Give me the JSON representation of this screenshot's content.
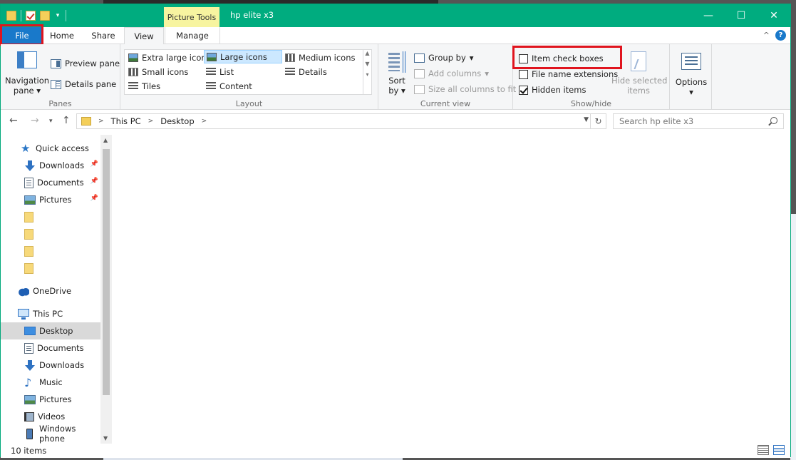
{
  "window": {
    "title": "hp elite x3",
    "context_tab": "Picture Tools",
    "controls": {
      "minimize": "—",
      "maximize": "☐",
      "close": "✕"
    }
  },
  "tabs": {
    "file": "File",
    "home": "Home",
    "share": "Share",
    "view": "View",
    "manage": "Manage"
  },
  "ribbon": {
    "panes": {
      "label": "Panes",
      "navigation_pane": "Navigation",
      "navigation_pane_2": "pane",
      "preview_pane": "Preview pane",
      "details_pane": "Details pane"
    },
    "layout": {
      "label": "Layout",
      "items": [
        "Extra large icons",
        "Large icons",
        "Medium icons",
        "Small icons",
        "List",
        "Details",
        "Tiles",
        "Content"
      ],
      "selected": "Large icons"
    },
    "current_view": {
      "label": "Current view",
      "sort_by": "Sort",
      "sort_by_2": "by",
      "group_by": "Group by",
      "add_columns": "Add columns",
      "size_all_columns": "Size all columns to fit"
    },
    "show_hide": {
      "label": "Show/hide",
      "item_check_boxes": "Item check boxes",
      "file_name_extensions": "File name extensions",
      "hidden_items": "Hidden items",
      "hide_selected": "Hide selected",
      "hide_selected_2": "items",
      "checked": {
        "item_check_boxes": false,
        "file_name_extensions": false,
        "hidden_items": true
      }
    },
    "options": "Options"
  },
  "address": {
    "crumbs": [
      "This PC",
      "Desktop"
    ],
    "search_placeholder": "Search hp elite x3"
  },
  "nav": {
    "quick_access": "Quick access",
    "qa_items": [
      "Downloads",
      "Documents",
      "Pictures"
    ],
    "onedrive": "OneDrive",
    "this_pc": "This PC",
    "pc_items": [
      "Desktop",
      "Documents",
      "Downloads",
      "Music",
      "Pictures",
      "Videos",
      "Windows phone"
    ]
  },
  "status": {
    "item_count": "10 items"
  },
  "colors": {
    "titlebar": "#00ac7f",
    "file_tab": "#1979ca",
    "highlight": "#e0141e",
    "context_tab": "#f7f4a0"
  }
}
